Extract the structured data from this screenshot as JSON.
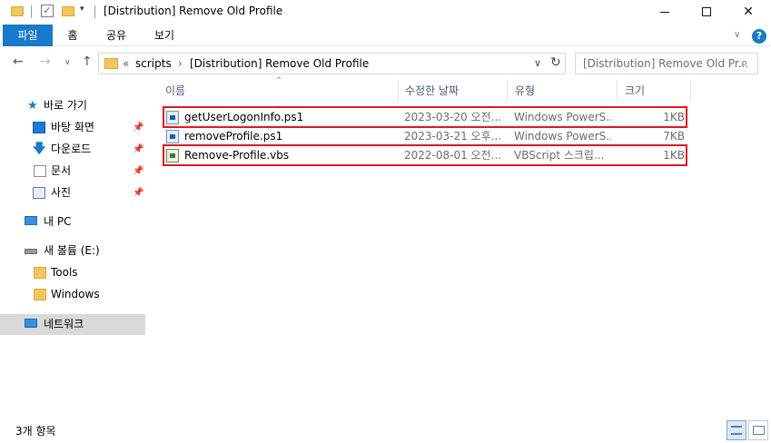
{
  "window": {
    "title": "[Distribution] Remove Old Profile"
  },
  "ribbon": {
    "tabs": [
      "파일",
      "홈",
      "공유",
      "보기"
    ]
  },
  "address": {
    "chevron": "«",
    "crumbs": [
      "scripts",
      "[Distribution] Remove Old Profile"
    ],
    "separator": "›"
  },
  "search": {
    "placeholder": "[Distribution] Remove Old Pr..."
  },
  "sidebar": {
    "quick_access": "바로 가기",
    "pinned": [
      "바탕 화면",
      "다운로드",
      "문서",
      "사진"
    ],
    "this_pc": "내 PC",
    "drive": "새 볼륨 (E:)",
    "folders": [
      "Tools",
      "Windows"
    ],
    "network": "네트워크"
  },
  "columns": {
    "name": "이름",
    "date": "수정한 날짜",
    "type": "유형",
    "size": "크기"
  },
  "files": [
    {
      "name": "getUserLogonInfo.ps1",
      "date": "2023-03-20 오전...",
      "type": "Windows PowerS...",
      "size": "1KB",
      "icon": "powershell-file-icon",
      "highlighted": true
    },
    {
      "name": "removeProfile.ps1",
      "date": "2023-03-21 오후...",
      "type": "Windows PowerS...",
      "size": "7KB",
      "icon": "powershell-file-icon",
      "highlighted": false
    },
    {
      "name": "Remove-Profile.vbs",
      "date": "2022-08-01 오전...",
      "type": "VBScript 스크립...",
      "size": "1KB",
      "icon": "vbscript-file-icon",
      "highlighted": true
    }
  ],
  "status": {
    "item_count": "3개 항목"
  },
  "colors": {
    "accent": "#1979ca",
    "highlight_border": "#e0191b",
    "selected_nav": "#d9d9d9"
  }
}
